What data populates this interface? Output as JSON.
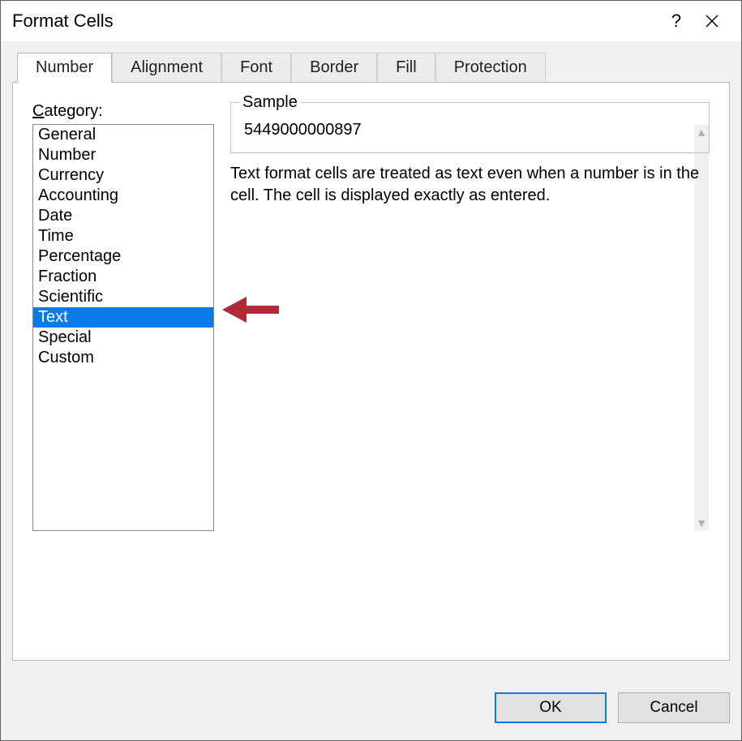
{
  "dialog": {
    "title": "Format Cells",
    "help_glyph": "?",
    "ok_label": "OK",
    "cancel_label": "Cancel"
  },
  "tabs": [
    {
      "label": "Number",
      "active": true
    },
    {
      "label": "Alignment",
      "active": false
    },
    {
      "label": "Font",
      "active": false
    },
    {
      "label": "Border",
      "active": false
    },
    {
      "label": "Fill",
      "active": false
    },
    {
      "label": "Protection",
      "active": false
    }
  ],
  "category": {
    "label_prefix": "C",
    "label_rest": "ategory:",
    "items": [
      "General",
      "Number",
      "Currency",
      "Accounting",
      "Date",
      "Time",
      "Percentage",
      "Fraction",
      "Scientific",
      "Text",
      "Special",
      "Custom"
    ],
    "selected_index": 9
  },
  "sample": {
    "legend": "Sample",
    "value": "5449000000897"
  },
  "description": "Text format cells are treated as text even when a number is in the cell. The cell is displayed exactly as entered.",
  "annotation": {
    "arrow_color": "#b02a37"
  }
}
